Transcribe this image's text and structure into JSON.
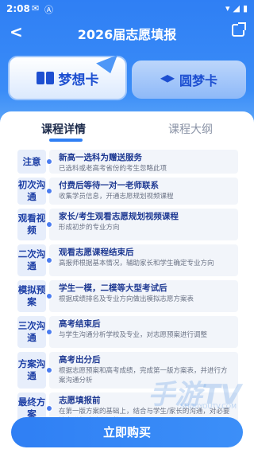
{
  "status": {
    "time": "2:08",
    "icons": [
      "mail-icon",
      "a-icon"
    ]
  },
  "nav": {
    "back": "<",
    "title": "2026届志愿填报"
  },
  "cards": {
    "dream": "梦想卡",
    "round": "圆梦卡"
  },
  "subtabs": {
    "active": "课程详情",
    "inactive": "课程大纲"
  },
  "rows": [
    {
      "tag": "注意",
      "title": "新高一选科为赠送服务",
      "desc": "已选科或老高考省份的考生忽略此项"
    },
    {
      "tag": "初次沟通",
      "title": "付费后等待一对一老师联系",
      "desc": "收集学员信息，开通志愿规划视频课程"
    },
    {
      "tag": "观看视频",
      "title": "家长/考生观看志愿规划视频课程",
      "desc": "形成初步的专业方向"
    },
    {
      "tag": "二次沟通",
      "title": "观看志愿课程结束后",
      "desc": "高报师根据基本情况，辅助家长和学生确定专业方向"
    },
    {
      "tag": "模拟预案",
      "title": "学生一模，二模等大型考试后",
      "desc": "根据成绩排名及专业方向做出模拟志愿方案表"
    },
    {
      "tag": "三次沟通",
      "title": "高考结束后",
      "desc": "与学生沟通分析学校及专业，对志愿预案进行调整"
    },
    {
      "tag": "方案沟通",
      "title": "高考出分后",
      "desc": "根据志愿预案和高考成绩，完成第一版方案表，并进行方案沟通分析"
    },
    {
      "tag": "最终方案",
      "title": "志愿填报前",
      "desc": "在第一版方案的基础上，结合与学生/家长的沟通，对必要地方进行改动和调整，"
    }
  ],
  "buy": "立即购买",
  "watermark": {
    "main": "手游TV",
    "sub": "SHOUYOUTV.COM"
  }
}
